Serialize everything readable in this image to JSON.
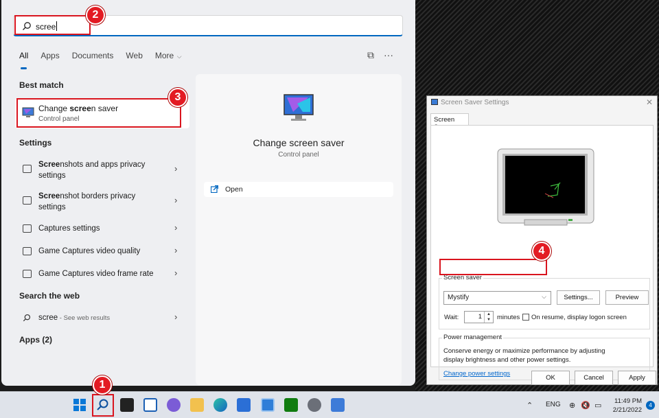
{
  "search": {
    "query": "scree"
  },
  "tabs": [
    "All",
    "Apps",
    "Documents",
    "Web",
    "More"
  ],
  "sections": {
    "best_match": "Best match",
    "settings": "Settings",
    "search_web": "Search the web",
    "apps": "Apps (2)"
  },
  "best_match": {
    "pre": "Change ",
    "bold": "scree",
    "post": "n saver",
    "subtitle": "Control panel"
  },
  "settings_items": [
    {
      "bold": "Scree",
      "rest": "nshots and apps privacy",
      "line2": "settings"
    },
    {
      "bold": "Scree",
      "rest": "nshot borders privacy",
      "line2": "settings"
    },
    {
      "label": "Captures settings"
    },
    {
      "label": "Game Captures video quality"
    },
    {
      "label": "Game Captures video frame rate"
    }
  ],
  "web_item": {
    "query": "scree",
    "suffix": " - See web results"
  },
  "detail": {
    "title": "Change screen saver",
    "subtitle": "Control panel",
    "open": "Open"
  },
  "badges": [
    "1",
    "2",
    "3",
    "4"
  ],
  "dialog": {
    "title": "Screen Saver Settings",
    "tab": "Screen Saver",
    "screen_saver_legend": "Screen saver",
    "selected_saver": "Mystify",
    "settings_btn": "Settings...",
    "preview_btn": "Preview",
    "wait_label": "Wait:",
    "wait_value": "1",
    "minutes_label": "minutes",
    "resume_label": "On resume, display logon screen",
    "power_legend": "Power management",
    "power_text_1": "Conserve energy or maximize performance by adjusting",
    "power_text_2": "display brightness and other power settings.",
    "power_link": "Change power settings",
    "ok": "OK",
    "cancel": "Cancel",
    "apply": "Apply"
  },
  "taskbar": {
    "lang": "ENG",
    "time": "11:49 PM",
    "date": "2/21/2022",
    "notifications": "4"
  },
  "colors": {
    "accent": "#0067c0",
    "annotation": "#e31b23"
  }
}
